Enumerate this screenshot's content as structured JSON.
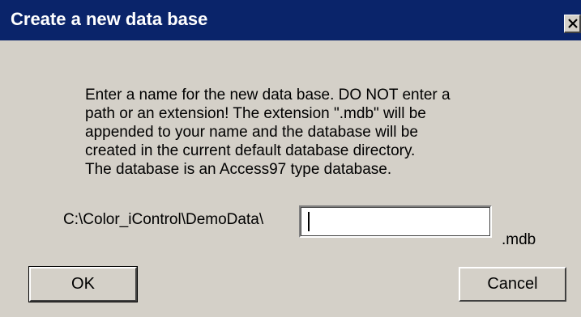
{
  "window": {
    "title": "Create a new data base",
    "close_icon": "close-icon"
  },
  "message": {
    "lines": [
      "Enter a name for the new data base. DO NOT enter a",
      "path or an extension! The extension \".mdb\" will be",
      "appended to your name and the database will be",
      "created in the current default database directory.",
      "The database is an  Access97 type database."
    ]
  },
  "form": {
    "path_prefix": "C:\\Color_iControl\\DemoData\\",
    "name_value": "",
    "extension": ".mdb"
  },
  "buttons": {
    "ok_label": "OK",
    "cancel_label": "Cancel"
  },
  "colors": {
    "titlebar": "#0a246a",
    "dialog_face": "#d4d0c8"
  }
}
